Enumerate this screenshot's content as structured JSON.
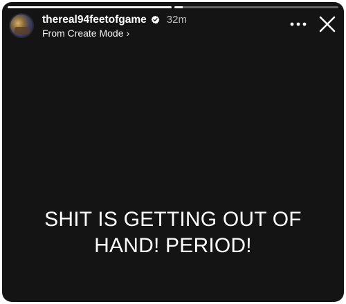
{
  "story": {
    "background": "#141414",
    "progress": [
      {
        "fill_fraction": 1.0
      },
      {
        "fill_fraction": 0.05
      }
    ],
    "header": {
      "username": "thereal94feetofgame",
      "verified_icon": "verified-badge-icon",
      "time": "32m",
      "subtitle": "From Create Mode",
      "subtitle_chevron": "›",
      "more_icon": "more-options-icon",
      "close_icon": "close-icon"
    },
    "message": "SHIT IS GETTING OUT OF\nHAND!  PERIOD!"
  }
}
